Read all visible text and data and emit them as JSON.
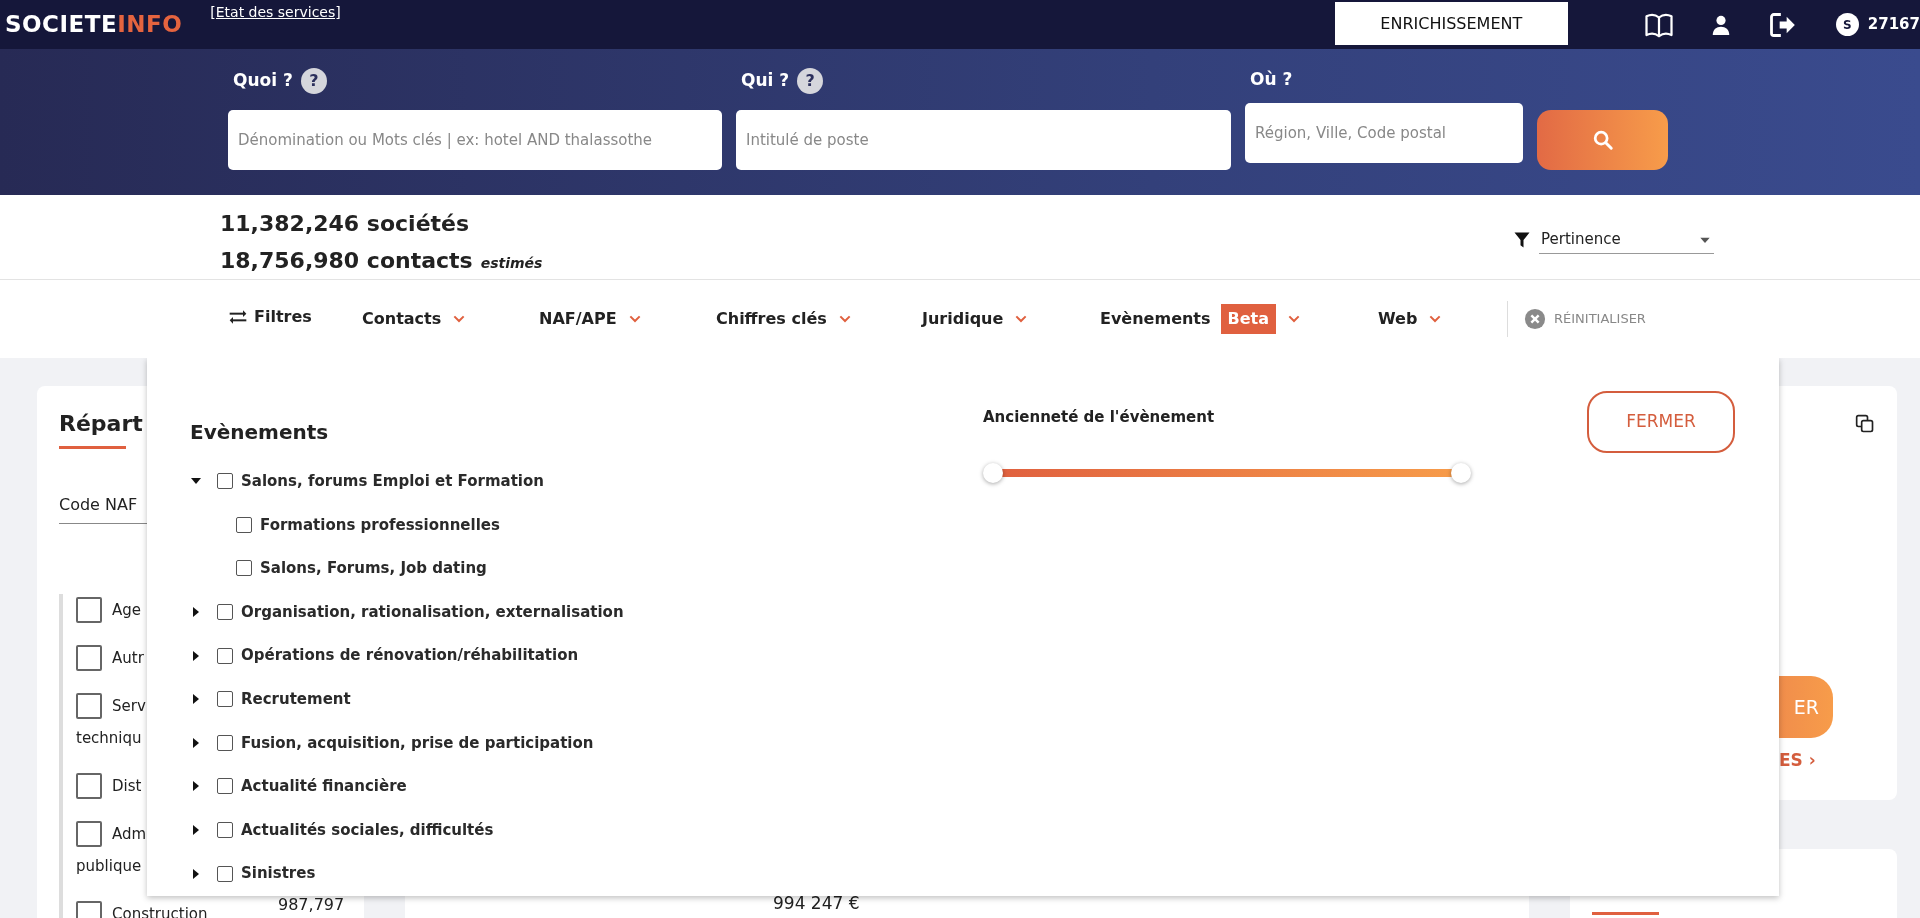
{
  "header": {
    "logo_part_1": "SOCIETE",
    "logo_part_2": "INFO",
    "status_link": "[Etat des services]",
    "enrich_button": "ENRICHISSEMENT",
    "avatar_initial": "S",
    "credits": "27167"
  },
  "search": {
    "fields": [
      {
        "label": "Quoi ?",
        "help": "?",
        "placeholder": "Dénomination ou Mots clés | ex: hotel AND thalassothe"
      },
      {
        "label": "Qui ?",
        "help": "?",
        "placeholder": "Intitulé de poste"
      },
      {
        "label": "Où ?",
        "placeholder": "Région, Ville, Code postal"
      }
    ]
  },
  "stats": {
    "companies": "11,382,246 sociétés",
    "contacts": "18,756,980 contacts",
    "contacts_note": "estimés"
  },
  "sort": {
    "value": "Pertinence"
  },
  "filters": {
    "label": "Filtres",
    "tabs": [
      {
        "label": "Contacts"
      },
      {
        "label": "NAF/APE"
      },
      {
        "label": "Chiffres clés"
      },
      {
        "label": "Juridique"
      },
      {
        "label": "Evènements",
        "badge": "Beta"
      },
      {
        "label": "Web"
      }
    ],
    "reset": "RÉINITIALISER"
  },
  "background": {
    "left_card": {
      "title": "Répart",
      "field": "Code NAF",
      "items": [
        {
          "lines": [
            "Age"
          ],
          "checked": false
        },
        {
          "lines": [
            "Autr"
          ],
          "checked": false
        },
        {
          "lines": [
            "Serv",
            "techniqu"
          ],
          "checked": false
        },
        {
          "lines": [
            "Dist"
          ],
          "checked": false
        },
        {
          "lines": [
            "Adm",
            "publique"
          ],
          "checked": false
        },
        {
          "lines": [
            "Construction"
          ],
          "checked": false,
          "count": "987,797"
        }
      ]
    },
    "middle_card": {
      "amount": "994 247 €"
    },
    "right_card": {
      "button": "ER",
      "link": "ES ›"
    }
  },
  "events_panel": {
    "title": "Evènements",
    "tree": [
      {
        "label": "Salons, forums Emploi et Formation",
        "checked": false,
        "expanded": true,
        "children": [
          {
            "label": "Formations professionnelles",
            "checked": false
          },
          {
            "label": "Salons, Forums, Job dating",
            "checked": false
          }
        ]
      },
      {
        "label": "Organisation, rationalisation, externalisation",
        "checked": false,
        "expanded": false
      },
      {
        "label": "Opérations de rénovation/réhabilitation",
        "checked": false,
        "expanded": false
      },
      {
        "label": "Recrutement",
        "checked": false,
        "expanded": false
      },
      {
        "label": "Fusion, acquisition, prise de participation",
        "checked": false,
        "expanded": false
      },
      {
        "label": "Actualité financière",
        "checked": false,
        "expanded": false
      },
      {
        "label": "Actualités sociales, difficultés",
        "checked": false,
        "expanded": false
      },
      {
        "label": "Sinistres",
        "checked": false,
        "expanded": false
      }
    ],
    "age_filter": {
      "title": "Ancienneté de l'évènement",
      "thumbs": [
        {
          "level": 0
        },
        {
          "level": 1
        }
      ]
    },
    "close_button": "FERMER"
  }
}
